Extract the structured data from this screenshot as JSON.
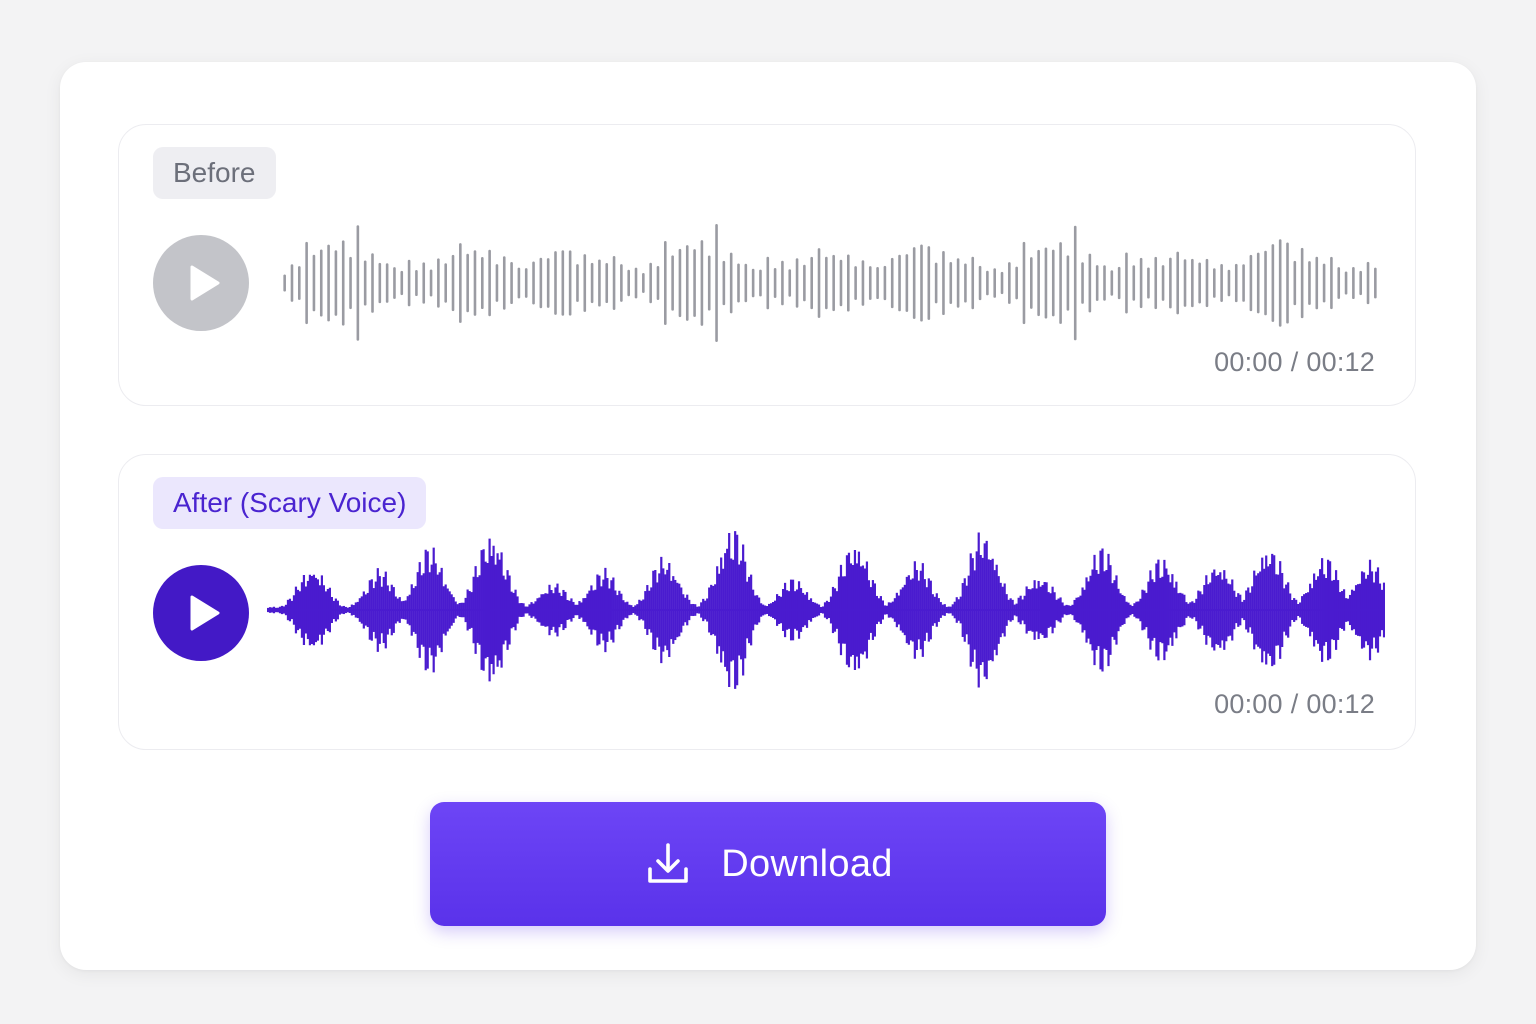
{
  "before": {
    "tag_label": "Before",
    "current_time": "00:00",
    "separator": "/",
    "total_time": "00:12",
    "play_icon": "play-icon",
    "wave_color": "#9a9ba2",
    "button_color": "#c3c4c9"
  },
  "after": {
    "tag_label": "After (Scary Voice)",
    "current_time": "00:00",
    "separator": "/",
    "total_time": "00:12",
    "play_icon": "play-icon",
    "wave_color": "#4a1bcf",
    "button_color": "#4319c6"
  },
  "download": {
    "label": "Download",
    "icon": "download-icon"
  },
  "colors": {
    "accent": "#5f37ee",
    "tag_purple_bg": "#ebe7fd",
    "tag_purple_text": "#4a24d0",
    "tag_grey_bg": "#eeeef2",
    "tag_grey_text": "#6c6f7a"
  }
}
